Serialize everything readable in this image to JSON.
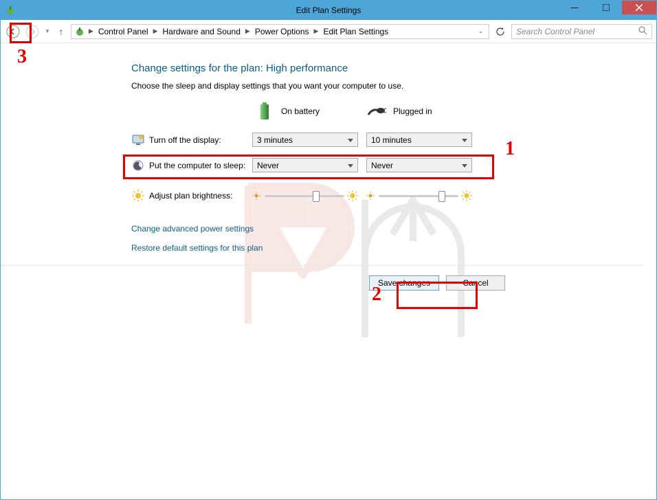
{
  "titlebar": {
    "title": "Edit Plan Settings"
  },
  "breadcrumbs": {
    "item1": "Control Panel",
    "item2": "Hardware and Sound",
    "item3": "Power Options",
    "item4": "Edit Plan Settings"
  },
  "search": {
    "placeholder": "Search Control Panel"
  },
  "heading": "Change settings for the plan: High performance",
  "subheading": "Choose the sleep and display settings that you want your computer to use.",
  "columns": {
    "battery": "On battery",
    "plugged": "Plugged in"
  },
  "rows": {
    "display": {
      "label": "Turn off the display:",
      "battery": "3 minutes",
      "plugged": "10 minutes"
    },
    "sleep": {
      "label": "Put the computer to sleep:",
      "battery": "Never",
      "plugged": "Never"
    },
    "brightness": {
      "label": "Adjust plan brightness:"
    }
  },
  "links": {
    "advanced": "Change advanced power settings",
    "restore": "Restore default settings for this plan"
  },
  "buttons": {
    "save": "Save changes",
    "cancel": "Cancel"
  },
  "annotations": {
    "n1": "1",
    "n2": "2",
    "n3": "3"
  }
}
